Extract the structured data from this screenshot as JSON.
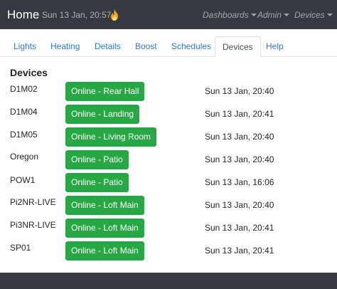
{
  "navbar": {
    "brand": "Home",
    "datetime": "Sun 13 Jan, 20:57",
    "status_icon": "flame-icon",
    "menus": [
      {
        "label": "Dashboards"
      },
      {
        "label": "Admin"
      },
      {
        "label": "Devices"
      }
    ]
  },
  "tabs": [
    {
      "label": "Lights"
    },
    {
      "label": "Heating"
    },
    {
      "label": "Details"
    },
    {
      "label": "Boost"
    },
    {
      "label": "Schedules"
    },
    {
      "label": "Devices",
      "active": true
    },
    {
      "label": "Help"
    }
  ],
  "devices": {
    "title": "Devices",
    "rows": [
      {
        "name": "D1M02",
        "status": "Online - Rear Hall",
        "time": "Sun 13 Jan, 20:40"
      },
      {
        "name": "D1M04",
        "status": "Online - Landing",
        "time": "Sun 13 Jan, 20:41"
      },
      {
        "name": "D1M05",
        "status": "Online - Living Room",
        "time": "Sun 13 Jan, 20:40"
      },
      {
        "name": "Oregon",
        "status": "Online - Patio",
        "time": "Sun 13 Jan, 20:40"
      },
      {
        "name": "POW1",
        "status": "Online - Patio",
        "time": "Sun 13 Jan, 16:06"
      },
      {
        "name": "Pi2NR-LIVE",
        "status": "Online - Loft Main",
        "time": "Sun 13 Jan, 20:40"
      },
      {
        "name": "Pi3NR-LIVE",
        "status": "Online - Loft Main",
        "time": "Sun 13 Jan, 20:41"
      },
      {
        "name": "SP01",
        "status": "Online - Loft Main",
        "time": "Sun 13 Jan, 20:41"
      }
    ]
  },
  "colors": {
    "navbar_bg": "#343a40",
    "online_green": "#28a745",
    "link_blue": "#2a7ad8"
  }
}
